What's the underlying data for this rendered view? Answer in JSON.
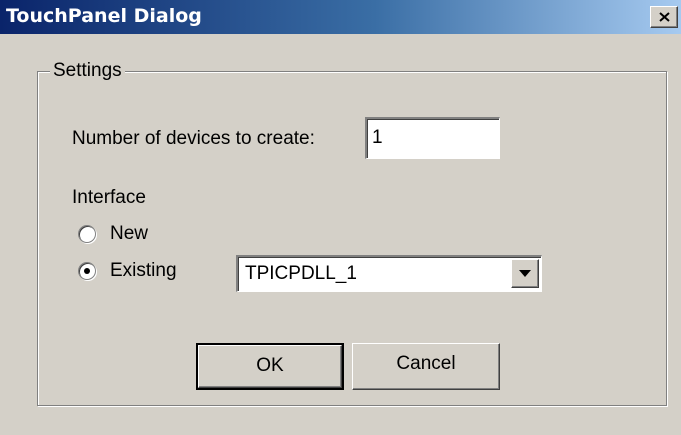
{
  "window": {
    "title": "TouchPanel Dialog",
    "close_glyph": "X"
  },
  "settings": {
    "group_label": "Settings",
    "devices_label": "Number of devices to create:",
    "devices_value": "1",
    "interface_label": "Interface",
    "radio_new_label": "New",
    "radio_existing_label": "Existing",
    "selected_interface": "Existing",
    "existing_combo_value": "TPICPDLL_1"
  },
  "buttons": {
    "ok_label": "OK",
    "cancel_label": "Cancel"
  },
  "colors": {
    "title_gradient_start": "#0a246a",
    "title_gradient_end": "#a6caf0",
    "face": "#d4d0c8"
  }
}
